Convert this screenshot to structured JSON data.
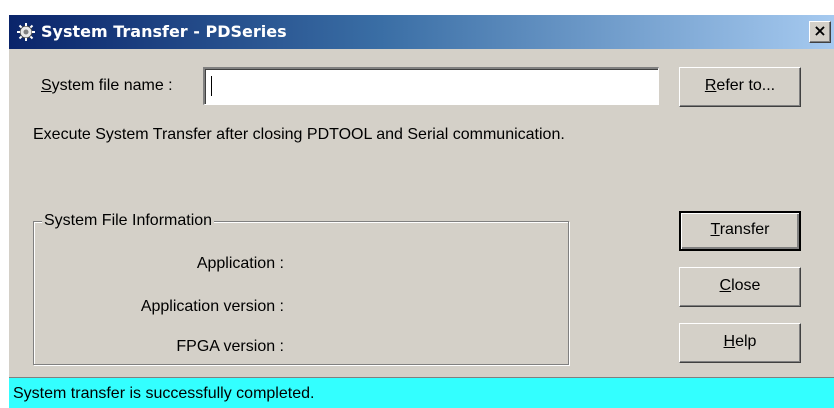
{
  "window": {
    "title": "System Transfer - PDSeries",
    "close_glyph": "×",
    "app_icon": "pdseries-app-icon"
  },
  "file": {
    "label_mnemonic": "S",
    "label_rest": "ystem file name :",
    "value": ""
  },
  "buttons": {
    "refer": {
      "mnemonic": "R",
      "rest": "efer to..."
    },
    "transfer": {
      "mnemonic": "T",
      "rest": "ransfer"
    },
    "close": {
      "mnemonic": "C",
      "rest": "lose"
    },
    "help": {
      "mnemonic": "H",
      "rest": "elp"
    }
  },
  "instruction": "Execute System Transfer after closing PDTOOL and Serial communication.",
  "info": {
    "legend": "System File Information",
    "application_label": "Application :",
    "application_version_label": "Application version :",
    "fpga_version_label": "FPGA version :"
  },
  "status": {
    "text": "System transfer is successfully completed.",
    "color": "#33ffff"
  },
  "colors": {
    "title_active": "#0a246a",
    "face": "#d4d0c8"
  }
}
